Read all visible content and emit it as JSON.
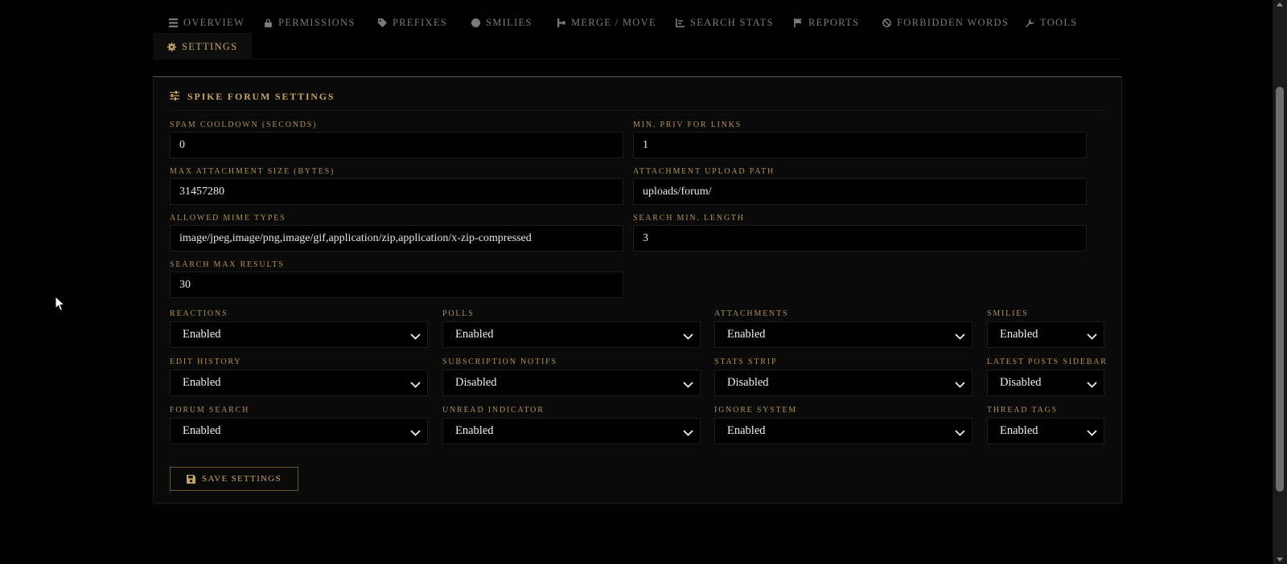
{
  "tabs": [
    {
      "label": "OVERVIEW",
      "icon": "overview-icon"
    },
    {
      "label": "PERMISSIONS",
      "icon": "lock-icon"
    },
    {
      "label": "PREFIXES",
      "icon": "tag-icon"
    },
    {
      "label": "SMILIES",
      "icon": "smiley-icon"
    },
    {
      "label": "MERGE / MOVE",
      "icon": "merge-icon"
    },
    {
      "label": "SEARCH STATS",
      "icon": "bar-chart-icon"
    },
    {
      "label": "REPORTS",
      "icon": "flag-icon"
    },
    {
      "label": "FORBIDDEN WORDS",
      "icon": "ban-icon"
    },
    {
      "label": "TOOLS",
      "icon": "wrench-icon"
    },
    {
      "label": "SETTINGS",
      "icon": "gear-icon",
      "active": true
    }
  ],
  "panel": {
    "title": "SPIKE FORUM SETTINGS",
    "icon": "sliders-icon"
  },
  "fields": {
    "spam_cooldown": {
      "label": "SPAM COOLDOWN (SECONDS)",
      "value": "0"
    },
    "min_priv_links": {
      "label": "MIN. PRIV FOR LINKS",
      "value": "1"
    },
    "max_attachment_size": {
      "label": "MAX ATTACHMENT SIZE (BYTES)",
      "value": "31457280"
    },
    "attachment_upload_path": {
      "label": "ATTACHMENT UPLOAD PATH",
      "value": "uploads/forum/"
    },
    "allowed_mime_types": {
      "label": "ALLOWED MIME TYPES",
      "value": "image/jpeg,image/png,image/gif,application/zip,application/x-zip-compressed"
    },
    "search_min_length": {
      "label": "SEARCH MIN. LENGTH",
      "value": "3"
    },
    "search_max_results": {
      "label": "SEARCH MAX RESULTS",
      "value": "30"
    }
  },
  "toggles": [
    {
      "label": "REACTIONS",
      "value": "Enabled"
    },
    {
      "label": "POLLS",
      "value": "Enabled"
    },
    {
      "label": "ATTACHMENTS",
      "value": "Enabled"
    },
    {
      "label": "SMILIES",
      "value": "Enabled"
    },
    {
      "label": "EDIT HISTORY",
      "value": "Enabled"
    },
    {
      "label": "SUBSCRIPTION NOTIFS",
      "value": "Disabled"
    },
    {
      "label": "STATS STRIP",
      "value": "Disabled"
    },
    {
      "label": "LATEST POSTS SIDEBAR",
      "value": "Disabled"
    },
    {
      "label": "FORUM SEARCH",
      "value": "Enabled"
    },
    {
      "label": "UNREAD INDICATOR",
      "value": "Enabled"
    },
    {
      "label": "IGNORE SYSTEM",
      "value": "Enabled"
    },
    {
      "label": "THREAD TAGS",
      "value": "Enabled"
    }
  ],
  "save_button": {
    "label": "SAVE SETTINGS",
    "icon": "floppy-disk-icon"
  },
  "colors": {
    "accent": "#c6a36a",
    "background": "#000000",
    "panel": "#0a0a0a"
  }
}
